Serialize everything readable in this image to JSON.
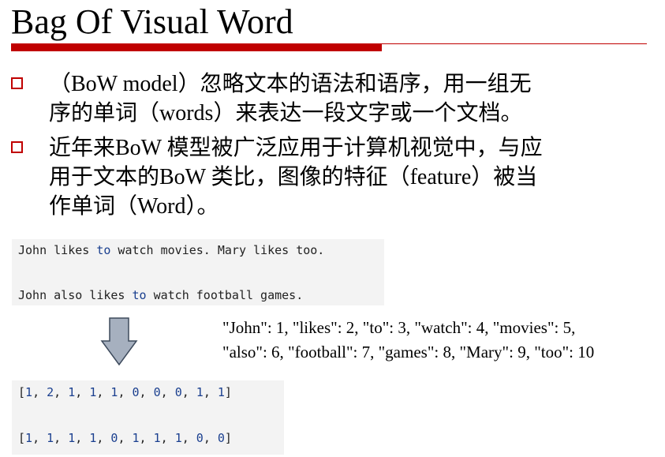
{
  "title": "Bag Of Visual Word",
  "bullets": [
    {
      "text": "（BoW model）忽略文本的语法和语序，用一组无\n序的单词（words）来表达一段文字或一个文档。"
    },
    {
      "text": "近年来BoW 模型被广泛应用于计算机视觉中，与应\n用于文本的BoW 类比，图像的特征（feature）被当\n作单词（Word）。"
    }
  ],
  "sentences": [
    {
      "pre": "John likes ",
      "kw": "to",
      "post": " watch movies. Mary likes too."
    },
    {
      "pre": "John also likes ",
      "kw": "to",
      "post": " watch football games."
    }
  ],
  "dictionary": {
    "line1": "\"John\": 1, \"likes\": 2, \"to\": 3, \"watch\": 4, \"movies\": 5,",
    "line2": "\"also\": 6, \"football\": 7, \"games\": 8, \"Mary\": 9, \"too\": 10"
  },
  "vectors": [
    [
      1,
      2,
      1,
      1,
      1,
      0,
      0,
      0,
      1,
      1
    ],
    [
      1,
      1,
      1,
      1,
      0,
      1,
      1,
      1,
      0,
      0
    ]
  ],
  "colors": {
    "accent": "#c00000",
    "code_keyword": "#1a3f8f",
    "code_background": "#f3f3f3",
    "arrow_fill": "#a6b0bf",
    "arrow_stroke": "#3d4a5c"
  },
  "icons": {
    "bullet": "square-bullet-icon",
    "transform": "down-arrow-icon"
  }
}
